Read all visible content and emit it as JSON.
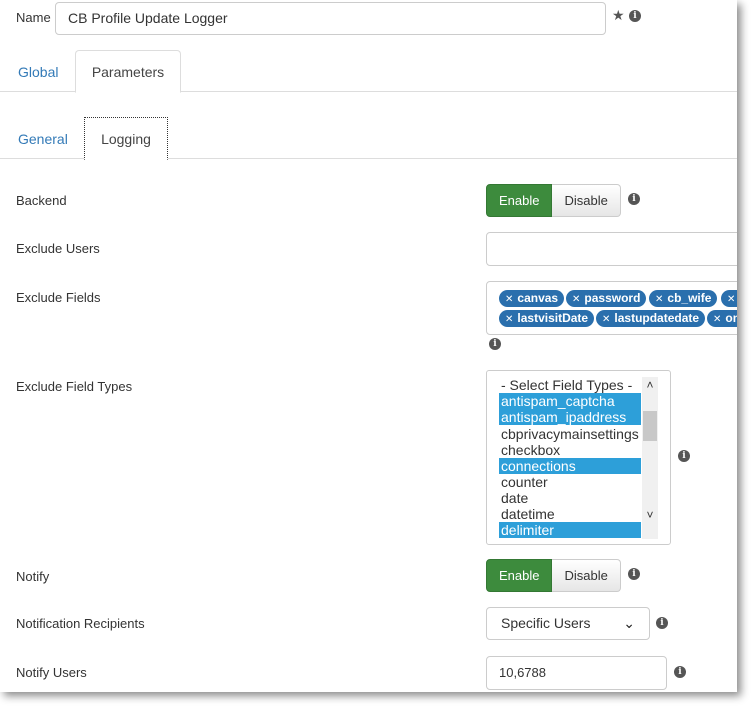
{
  "name_row": {
    "label": "Name",
    "value": "CB Profile Update Logger"
  },
  "tabs_top": [
    {
      "label": "Global",
      "active": false
    },
    {
      "label": "Parameters",
      "active": true
    }
  ],
  "tabs_sub": [
    {
      "label": "General",
      "active": false
    },
    {
      "label": "Logging",
      "active": true
    }
  ],
  "backend": {
    "label": "Backend",
    "enable": "Enable",
    "disable": "Disable",
    "selected": "Enable"
  },
  "exclude_users": {
    "label": "Exclude Users",
    "value": ""
  },
  "exclude_fields": {
    "label": "Exclude Fields",
    "tags": [
      "canvas",
      "password",
      "cb_wife",
      "c",
      "lastvisitDate",
      "lastupdatedate",
      "on"
    ]
  },
  "exclude_field_types": {
    "label": "Exclude Field Types",
    "options": [
      {
        "text": "- Select Field Types -",
        "selected": false
      },
      {
        "text": "antispam_captcha",
        "selected": true
      },
      {
        "text": "antispam_ipaddress",
        "selected": true
      },
      {
        "text": "cbprivacymainsettings",
        "selected": false
      },
      {
        "text": "checkbox",
        "selected": false
      },
      {
        "text": "connections",
        "selected": true
      },
      {
        "text": "counter",
        "selected": false
      },
      {
        "text": "date",
        "selected": false
      },
      {
        "text": "datetime",
        "selected": false
      },
      {
        "text": "delimiter",
        "selected": true
      }
    ]
  },
  "notify": {
    "label": "Notify",
    "enable": "Enable",
    "disable": "Disable",
    "selected": "Enable"
  },
  "notification_recipients": {
    "label": "Notification Recipients",
    "value": "Specific Users"
  },
  "notify_users": {
    "label": "Notify Users",
    "value": "10,6788"
  },
  "icons": {
    "info": "info-icon",
    "star": "star-icon",
    "tag_remove": "close-icon",
    "dropdown": "chevron-down-icon"
  },
  "colors": {
    "enable_green": "#3d8b3d",
    "tag_blue": "#2a6fad",
    "selected_option": "#2d9fd9",
    "link": "#337ab7"
  }
}
